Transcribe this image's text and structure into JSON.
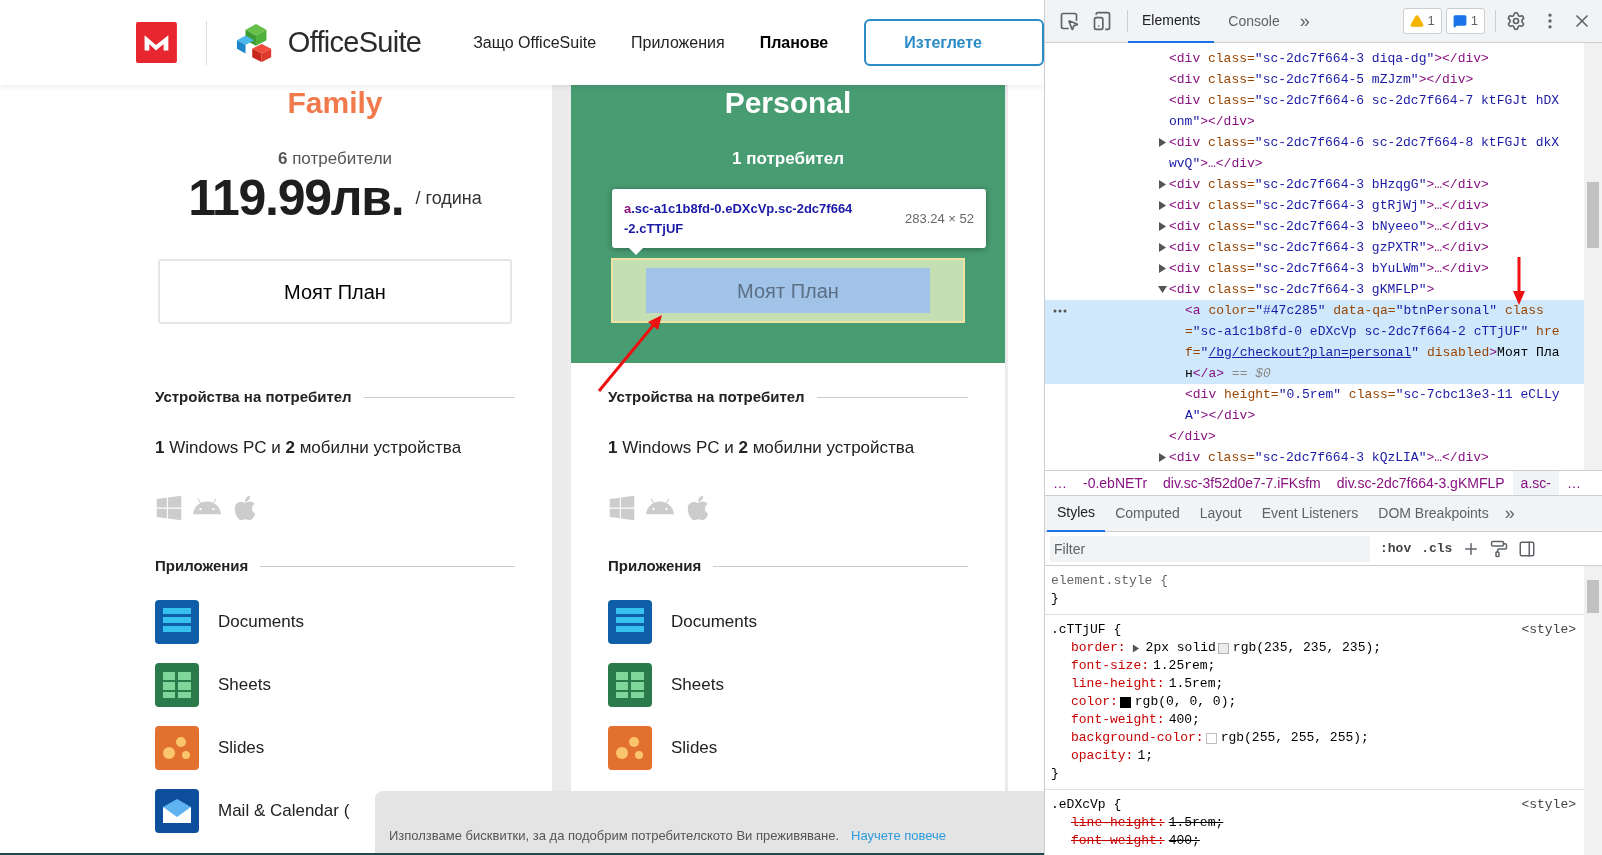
{
  "page": {
    "header": {
      "brand": "OfficeSuite",
      "nav": [
        {
          "label": "Защо OfficeSuite",
          "selected": false
        },
        {
          "label": "Приложения",
          "selected": false
        },
        {
          "label": "Планове",
          "selected": true
        }
      ],
      "cta": "Изтеглете"
    },
    "plans": [
      {
        "kind": "plain",
        "title": "Family",
        "users": "**6** потребители",
        "price": "119.99лв.",
        "period": "/ година",
        "button": "Моят План",
        "highlighted": false,
        "devices_heading": "Устройства на потребител",
        "devices": "**1** Windows PC и **2** мобилни устройства",
        "apps_heading": "Приложения",
        "apps": [
          {
            "kind": "documents",
            "name": "Documents"
          },
          {
            "kind": "sheets",
            "name": "Sheets"
          },
          {
            "kind": "slides",
            "name": "Slides"
          },
          {
            "kind": "mail",
            "name": "Mail & Calendar ("
          }
        ]
      },
      {
        "kind": "featured",
        "title": "Personal",
        "users": "**1** потребител",
        "button": "Моят План",
        "highlighted": true,
        "tooltip": {
          "tag": "a",
          "classes": ".sc-a1c1b8fd-0.eDXcVp.sc-2dc7f664-2.cTTjUF",
          "size": "283.24 × 52"
        },
        "devices_heading": "Устройства на потребител",
        "devices": "**1** Windows PC и **2** мобилни устройства",
        "apps_heading": "Приложения",
        "apps": [
          {
            "kind": "documents",
            "name": "Documents"
          },
          {
            "kind": "sheets",
            "name": "Sheets"
          },
          {
            "kind": "slides",
            "name": "Slides"
          }
        ]
      }
    ],
    "cookie_banner": {
      "text": "Използваме бисквитки, за да подобрим потребителското Ви преживяване.",
      "link": "Научете повече"
    }
  },
  "devtools": {
    "tabs": [
      {
        "label": "Elements",
        "selected": true
      },
      {
        "label": "Console",
        "selected": false
      }
    ],
    "more_tabs": "»",
    "warnings": "1",
    "messages": "1",
    "dom_tree": [
      {
        "kind": "leaf",
        "selected": false,
        "tokens": [
          {
            "kind": "tag",
            "text": "<div "
          },
          {
            "kind": "attr",
            "text": "class="
          },
          {
            "kind": "val",
            "text": "\"sc-2dc7f664-3 diqa-dg\""
          },
          {
            "kind": "tag",
            "text": "></div>"
          }
        ]
      },
      {
        "kind": "leaf",
        "selected": false,
        "tokens": [
          {
            "kind": "tag",
            "text": "<div "
          },
          {
            "kind": "attr",
            "text": "class="
          },
          {
            "kind": "val",
            "text": "\"sc-2dc7f664-5 mZJzm\""
          },
          {
            "kind": "tag",
            "text": "></div>"
          }
        ]
      },
      {
        "kind": "leaf",
        "selected": false,
        "tokens": [
          {
            "kind": "tag",
            "text": "<div "
          },
          {
            "kind": "attr",
            "text": "class="
          },
          {
            "kind": "val",
            "text": "\"sc-2dc7f664-6 sc-2dc7f664-7 ktFGJt hDXonm\""
          },
          {
            "kind": "tag",
            "text": "></div>"
          }
        ]
      },
      {
        "kind": "parent",
        "expanded": false,
        "selected": false,
        "tokens": [
          {
            "kind": "tag",
            "text": "<div "
          },
          {
            "kind": "attr",
            "text": "class="
          },
          {
            "kind": "val",
            "text": "\"sc-2dc7f664-6 sc-2dc7f664-8 ktFGJt dkXwvQ\""
          },
          {
            "kind": "tag",
            "text": ">…</div>"
          }
        ]
      },
      {
        "kind": "parent",
        "expanded": false,
        "selected": false,
        "tokens": [
          {
            "kind": "tag",
            "text": "<div "
          },
          {
            "kind": "attr",
            "text": "class="
          },
          {
            "kind": "val",
            "text": "\"sc-2dc7f664-3 bHzqgG\""
          },
          {
            "kind": "tag",
            "text": ">…</div>"
          }
        ]
      },
      {
        "kind": "parent",
        "expanded": false,
        "selected": false,
        "tokens": [
          {
            "kind": "tag",
            "text": "<div "
          },
          {
            "kind": "attr",
            "text": "class="
          },
          {
            "kind": "val",
            "text": "\"sc-2dc7f664-3 gtRjWj\""
          },
          {
            "kind": "tag",
            "text": ">…</div>"
          }
        ]
      },
      {
        "kind": "parent",
        "expanded": false,
        "selected": false,
        "tokens": [
          {
            "kind": "tag",
            "text": "<div "
          },
          {
            "kind": "attr",
            "text": "class="
          },
          {
            "kind": "val",
            "text": "\"sc-2dc7f664-3 bNyeeo\""
          },
          {
            "kind": "tag",
            "text": ">…</div>"
          }
        ]
      },
      {
        "kind": "parent",
        "expanded": false,
        "selected": false,
        "tokens": [
          {
            "kind": "tag",
            "text": "<div "
          },
          {
            "kind": "attr",
            "text": "class="
          },
          {
            "kind": "val",
            "text": "\"sc-2dc7f664-3 gzPXTR\""
          },
          {
            "kind": "tag",
            "text": ">…</div>"
          }
        ]
      },
      {
        "kind": "parent",
        "expanded": false,
        "selected": false,
        "tokens": [
          {
            "kind": "tag",
            "text": "<div "
          },
          {
            "kind": "attr",
            "text": "class="
          },
          {
            "kind": "val",
            "text": "\"sc-2dc7f664-3 bYuLWm\""
          },
          {
            "kind": "tag",
            "text": ">…</div>"
          }
        ]
      },
      {
        "kind": "parent",
        "expanded": true,
        "selected": false,
        "tokens": [
          {
            "kind": "tag",
            "text": "<div "
          },
          {
            "kind": "attr",
            "text": "class="
          },
          {
            "kind": "val",
            "text": "\"sc-2dc7f664-3 gKMFLP\""
          },
          {
            "kind": "tag",
            "text": ">"
          }
        ],
        "closing": "</div>",
        "children": [
          {
            "kind": "leaf",
            "selected": true,
            "tokens": [
              {
                "kind": "tag",
                "text": "<a "
              },
              {
                "kind": "attr",
                "text": "color="
              },
              {
                "kind": "val",
                "text": "\"#47c285\""
              },
              {
                "kind": "attr",
                "text": " data-qa="
              },
              {
                "kind": "val",
                "text": "\"btnPersonal\""
              },
              {
                "kind": "attr",
                "text": " class="
              },
              {
                "kind": "val",
                "text": "\"sc-a1c1b8fd-0 eDXcVp sc-2dc7f664-2 cTTjUF\""
              },
              {
                "kind": "attr",
                "text": " href="
              },
              {
                "kind": "val",
                "text": "\""
              },
              {
                "kind": "link",
                "text": "/bg/checkout?plan=personal"
              },
              {
                "kind": "val",
                "text": "\""
              },
              {
                "kind": "attr",
                "text": " disabled"
              },
              {
                "kind": "tag",
                "text": ">"
              },
              {
                "kind": "text",
                "text": "Моят План"
              },
              {
                "kind": "tag",
                "text": "</a>"
              },
              {
                "kind": "hint",
                "text": " == $0"
              }
            ]
          },
          {
            "kind": "leaf",
            "selected": false,
            "tokens": [
              {
                "kind": "tag",
                "text": "<div "
              },
              {
                "kind": "attr",
                "text": "height="
              },
              {
                "kind": "val",
                "text": "\"0.5rem\""
              },
              {
                "kind": "attr",
                "text": " class="
              },
              {
                "kind": "val",
                "text": "\"sc-7cbc13e3-11 eCLLyA\""
              },
              {
                "kind": "tag",
                "text": "></div>"
              }
            ]
          }
        ]
      },
      {
        "kind": "parent",
        "expanded": false,
        "selected": false,
        "tokens": [
          {
            "kind": "tag",
            "text": "<div "
          },
          {
            "kind": "attr",
            "text": "class="
          },
          {
            "kind": "val",
            "text": "\"sc-2dc7f664-3 kQzLIA\""
          },
          {
            "kind": "tag",
            "text": ">…</div>"
          }
        ]
      }
    ],
    "breadcrumbs": [
      {
        "text": "…",
        "selected": false
      },
      {
        "text": "-0.ebNETr",
        "selected": false
      },
      {
        "text": "div.sc-3f52d0e7-7.iFKsfm",
        "selected": false
      },
      {
        "text": "div.sc-2dc7f664-3.gKMFLP",
        "selected": false
      },
      {
        "text": "a.sc-",
        "selected": true
      },
      {
        "text": "…",
        "selected": false
      }
    ],
    "style_tabs": [
      {
        "label": "Styles",
        "selected": true
      },
      {
        "label": "Computed",
        "selected": false
      },
      {
        "label": "Layout",
        "selected": false
      },
      {
        "label": "Event Listeners",
        "selected": false
      },
      {
        "label": "DOM Breakpoints",
        "selected": false
      }
    ],
    "more_style_tabs": "»",
    "filter": {
      "placeholder": "Filter"
    },
    "hov": ":hov",
    "cls": ".cls",
    "rules": [
      {
        "selector": "element.style {",
        "close": "}"
      },
      {
        "selector": ".cTTjUF {",
        "source": "<style>",
        "close": "}",
        "props": [
          {
            "name": "border:",
            "expanded": false,
            "prefix": "2px solid ",
            "color": "#ebebeb",
            "value": "rgb(235, 235, 235);",
            "struck": false
          },
          {
            "name": "font-size:",
            "value": "1.25rem;",
            "struck": false
          },
          {
            "name": "line-height:",
            "value": "1.5rem;",
            "struck": false
          },
          {
            "name": "color:",
            "color": "#000000",
            "value": "rgb(0, 0, 0);",
            "struck": false
          },
          {
            "name": "font-weight:",
            "value": "400;",
            "struck": false
          },
          {
            "name": "background-color:",
            "color": "#ffffff",
            "value": "rgb(255, 255, 255);",
            "struck": false
          },
          {
            "name": "opacity:",
            "value": "1;",
            "struck": false
          }
        ]
      },
      {
        "selector": ".eDXcVp {",
        "source": "<style>",
        "props": [
          {
            "name": "line-height:",
            "value": "1.5rem;",
            "struck": true
          },
          {
            "name": "font-weight:",
            "value": "400;",
            "struck": true
          }
        ]
      }
    ]
  }
}
